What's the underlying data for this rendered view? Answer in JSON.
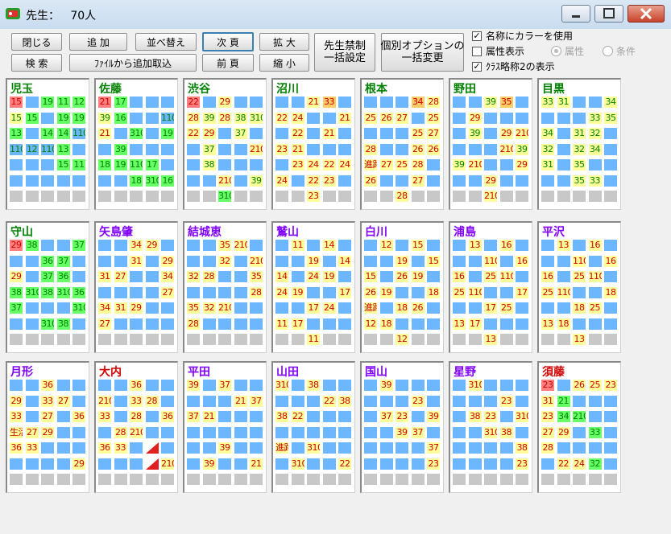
{
  "window": {
    "title_label": "先生：",
    "title_count": "70人"
  },
  "toolbar": {
    "close": "閉じる",
    "add": "追 加",
    "sort": "並べ替え",
    "next_page": "次 頁",
    "zoom_in": "拡 大",
    "search": "検 索",
    "import": "ﾌｧｲﾙから追加取込",
    "prev_page": "前 頁",
    "zoom_out": "縮 小",
    "bulk_ban_1": "先生禁制",
    "bulk_ban_2": "一括設定",
    "bulk_opt_1": "個別オプションの",
    "bulk_opt_2": "一括変更"
  },
  "options": {
    "use_color": "名称にカラーを使用",
    "use_color_checked": true,
    "show_attr": "属性表示",
    "show_attr_checked": false,
    "attr_radio": "属性",
    "cond_radio": "条件",
    "class_abbrev": "ｸﾗｽ略称2の表示",
    "class_abbrev_checked": true
  },
  "colors": {
    "blue": "#6cb7ff",
    "yellow": "#ffff99",
    "green": "#66ff66",
    "pink": "#ff7f7f",
    "orange": "#ffcc66",
    "gray": "#c8c8c8"
  },
  "legend": {
    "b": "blue free slot",
    "y": "yellow",
    "g": "green",
    "p": "pink",
    "o": "orange",
    "x": "gray",
    "w": "empty"
  },
  "teachers": [
    {
      "name": "児玉",
      "name_color": "green",
      "rows": [
        [
          "p:15",
          "b",
          "g:19",
          "g:11",
          "g:12"
        ],
        [
          "y:15",
          "g:15",
          "b",
          "g:19",
          "g:19"
        ],
        [
          "g:13",
          "b",
          "g:14",
          "g:14",
          "b:110"
        ],
        [
          "b:110",
          "b:12",
          "b:110",
          "g:13",
          "b"
        ],
        [
          "b",
          "b",
          "b",
          "g:15",
          "g:11"
        ],
        [
          "b",
          "b",
          "b",
          "b",
          "b"
        ],
        [
          "x",
          "x",
          "x",
          "x",
          "x"
        ]
      ]
    },
    {
      "name": "佐藤",
      "name_color": "green",
      "rows": [
        [
          "p:21",
          "g:17",
          "b",
          "b",
          "b"
        ],
        [
          "y:39",
          "g:16",
          "b",
          "b",
          "b:110"
        ],
        [
          "y:21",
          "b",
          "g:310",
          "b",
          "g:19"
        ],
        [
          "b",
          "g:39",
          "b",
          "b",
          "b"
        ],
        [
          "g:18",
          "g:19",
          "g:110",
          "g:17",
          "b"
        ],
        [
          "b",
          "b",
          "g:18",
          "g:310",
          "g:16"
        ],
        [
          "x",
          "x",
          "x",
          "x",
          "x"
        ]
      ]
    },
    {
      "name": "渋谷",
      "name_color": "green",
      "rows": [
        [
          "p:22",
          "b",
          "y:29",
          "b",
          "b"
        ],
        [
          "y:28",
          "y:39",
          "y:28",
          "y:38",
          "y:310"
        ],
        [
          "y:22",
          "y:29",
          "b",
          "y:37",
          "b"
        ],
        [
          "b",
          "y:37",
          "b",
          "b",
          "y:210"
        ],
        [
          "b",
          "y:38",
          "b",
          "b",
          "b"
        ],
        [
          "b",
          "b",
          "y:210",
          "b",
          "y:39"
        ],
        [
          "x",
          "x",
          "g:310",
          "x",
          "x"
        ]
      ]
    },
    {
      "name": "沼川",
      "name_color": "green",
      "rows": [
        [
          "b",
          "b",
          "y:21",
          "o:33",
          "b"
        ],
        [
          "y:22",
          "y:24",
          "b",
          "b",
          "y:21"
        ],
        [
          "b",
          "y:22",
          "b",
          "y:21",
          "b"
        ],
        [
          "y:23",
          "y:21",
          "b",
          "b",
          "b"
        ],
        [
          "b",
          "y:23",
          "y:24",
          "y:22",
          "y:24"
        ],
        [
          "y:24",
          "b",
          "y:22",
          "y:23",
          "b"
        ],
        [
          "x",
          "x",
          "y:23",
          "x",
          "x"
        ]
      ]
    },
    {
      "name": "根本",
      "name_color": "green",
      "rows": [
        [
          "b",
          "b",
          "b",
          "o:34",
          "y:28"
        ],
        [
          "y:25",
          "y:26",
          "y:27",
          "b",
          "y:25"
        ],
        [
          "b",
          "b",
          "b",
          "y:25",
          "y:27"
        ],
        [
          "y:28",
          "b",
          "b",
          "y:26",
          "y:26"
        ],
        [
          "y:進路",
          "y:27",
          "y:25",
          "y:28",
          "b"
        ],
        [
          "y:26",
          "b",
          "b",
          "y:27",
          "b"
        ],
        [
          "x",
          "x",
          "y:28",
          "x",
          "x"
        ]
      ]
    },
    {
      "name": "野田",
      "name_color": "green",
      "rows": [
        [
          "b",
          "b",
          "y:39",
          "o:35",
          "b"
        ],
        [
          "b",
          "y:29",
          "b",
          "b",
          "b"
        ],
        [
          "b",
          "y:39",
          "b",
          "y:29",
          "y:210"
        ],
        [
          "b",
          "b",
          "b",
          "y:210",
          "y:39"
        ],
        [
          "y:39",
          "y:210",
          "b",
          "b",
          "y:29"
        ],
        [
          "b",
          "b",
          "y:29",
          "b",
          "b"
        ],
        [
          "x",
          "x",
          "y:210",
          "x",
          "x"
        ]
      ]
    },
    {
      "name": "目黒",
      "name_color": "green",
      "rows": [
        [
          "y:33",
          "y:31",
          "b",
          "b",
          "y:34"
        ],
        [
          "b",
          "b",
          "b",
          "y:33",
          "y:35"
        ],
        [
          "y:34",
          "b",
          "y:31",
          "y:32",
          "b"
        ],
        [
          "y:32",
          "b",
          "y:32",
          "y:34",
          "b"
        ],
        [
          "y:31",
          "b",
          "y:35",
          "b",
          "b"
        ],
        [
          "b",
          "b",
          "y:35",
          "y:33",
          "b"
        ],
        [
          "x",
          "x",
          "x",
          "x",
          "x"
        ]
      ]
    },
    {
      "name": "守山",
      "name_color": "green",
      "rows": [
        [
          "p:29",
          "g:38",
          "b",
          "b",
          "g:37"
        ],
        [
          "b",
          "b",
          "g:36",
          "g:37",
          "b"
        ],
        [
          "y:29",
          "b",
          "g:37",
          "g:36",
          "b"
        ],
        [
          "g:38",
          "g:310",
          "g:38",
          "g:310",
          "g:36"
        ],
        [
          "g:37",
          "b",
          "b",
          "b",
          "g:310"
        ],
        [
          "b",
          "b",
          "g:310",
          "g:38",
          "b"
        ],
        [
          "x",
          "x",
          "x",
          "x",
          "x"
        ]
      ]
    },
    {
      "name": "矢島肇",
      "name_color": "purple",
      "rows": [
        [
          "b",
          "b",
          "y:34",
          "y:29",
          "b"
        ],
        [
          "b",
          "b",
          "y:31",
          "b",
          "y:29"
        ],
        [
          "y:31",
          "y:27",
          "b",
          "b",
          "y:34"
        ],
        [
          "b",
          "b",
          "b",
          "b",
          "y:27"
        ],
        [
          "y:34",
          "y:31",
          "y:29",
          "b",
          "b"
        ],
        [
          "y:27",
          "b",
          "b",
          "b",
          "b"
        ],
        [
          "x",
          "x",
          "x",
          "x",
          "x"
        ]
      ]
    },
    {
      "name": "結城恵",
      "name_color": "purple",
      "rows": [
        [
          "b",
          "b",
          "y:35",
          "y:210",
          "b"
        ],
        [
          "b",
          "b",
          "y:32",
          "b",
          "y:210"
        ],
        [
          "y:32",
          "y:28",
          "b",
          "b",
          "y:35"
        ],
        [
          "b",
          "b",
          "b",
          "b",
          "y:28"
        ],
        [
          "y:35",
          "y:32",
          "y:210",
          "b",
          "b"
        ],
        [
          "y:28",
          "b",
          "b",
          "b",
          "b"
        ],
        [
          "x",
          "x",
          "x",
          "x",
          "x"
        ]
      ]
    },
    {
      "name": "鷲山",
      "name_color": "purple",
      "rows": [
        [
          "b",
          "y:11",
          "b",
          "y:14",
          "b"
        ],
        [
          "b",
          "b",
          "y:19",
          "b",
          "y:14"
        ],
        [
          "y:14",
          "b",
          "y:24",
          "y:19",
          "b"
        ],
        [
          "y:24",
          "y:19",
          "b",
          "b",
          "y:17"
        ],
        [
          "b",
          "b",
          "y:17",
          "y:24",
          "b"
        ],
        [
          "y:11",
          "y:17",
          "b",
          "b",
          "b"
        ],
        [
          "x",
          "x",
          "y:11",
          "x",
          "x"
        ]
      ]
    },
    {
      "name": "白川",
      "name_color": "purple",
      "rows": [
        [
          "b",
          "y:12",
          "b",
          "y:15",
          "b"
        ],
        [
          "b",
          "b",
          "y:19",
          "b",
          "y:15"
        ],
        [
          "y:15",
          "b",
          "y:26",
          "y:19",
          "b"
        ],
        [
          "y:26",
          "y:19",
          "b",
          "b",
          "y:18"
        ],
        [
          "y:進路",
          "b",
          "y:18",
          "y:26",
          "b"
        ],
        [
          "y:12",
          "y:18",
          "b",
          "b",
          "b"
        ],
        [
          "x",
          "x",
          "y:12",
          "x",
          "x"
        ]
      ]
    },
    {
      "name": "浦島",
      "name_color": "purple",
      "rows": [
        [
          "b",
          "y:13",
          "b",
          "y:16",
          "b"
        ],
        [
          "b",
          "b",
          "y:110",
          "b",
          "y:16"
        ],
        [
          "y:16",
          "b",
          "y:25",
          "y:110",
          "b"
        ],
        [
          "y:25",
          "y:110",
          "b",
          "b",
          "y:17"
        ],
        [
          "b",
          "b",
          "y:17",
          "y:25",
          "b"
        ],
        [
          "y:13",
          "y:17",
          "b",
          "b",
          "b"
        ],
        [
          "x",
          "x",
          "y:13",
          "x",
          "x"
        ]
      ]
    },
    {
      "name": "平沢",
      "name_color": "purple",
      "rows": [
        [
          "b",
          "y:13",
          "b",
          "y:16",
          "b"
        ],
        [
          "b",
          "b",
          "y:110",
          "b",
          "y:16"
        ],
        [
          "y:16",
          "b",
          "y:25",
          "y:110",
          "b"
        ],
        [
          "y:25",
          "y:110",
          "b",
          "b",
          "y:18"
        ],
        [
          "b",
          "b",
          "y:18",
          "y:25",
          "b"
        ],
        [
          "y:13",
          "y:18",
          "b",
          "b",
          "b"
        ],
        [
          "x",
          "x",
          "y:13",
          "x",
          "x"
        ]
      ]
    },
    {
      "name": "月形",
      "name_color": "purple",
      "rows": [
        [
          "b",
          "b",
          "y:36",
          "b",
          "b"
        ],
        [
          "y:29",
          "b",
          "y:33",
          "y:27",
          "b"
        ],
        [
          "y:33",
          "b",
          "y:27",
          "b",
          "y:36"
        ],
        [
          "y:生活",
          "y:27",
          "y:29",
          "b",
          "b"
        ],
        [
          "y:36",
          "y:33",
          "b",
          "b",
          "b"
        ],
        [
          "b",
          "b",
          "b",
          "b",
          "y:29"
        ],
        [
          "x",
          "x",
          "x",
          "x",
          "x"
        ]
      ]
    },
    {
      "name": "大内",
      "name_color": "red",
      "rows": [
        [
          "b",
          "b",
          "y:36",
          "b",
          "b"
        ],
        [
          "y:210",
          "b",
          "y:33",
          "y:28",
          "b"
        ],
        [
          "y:33",
          "b",
          "y:28",
          "b",
          "y:36"
        ],
        [
          "b",
          "y:28",
          "y:210",
          "b",
          "b"
        ],
        [
          "y:36",
          "y:33",
          "b",
          "tri",
          "b"
        ],
        [
          "b",
          "b",
          "b",
          "tri",
          "y:210"
        ],
        [
          "x",
          "x",
          "x",
          "x",
          "x"
        ]
      ]
    },
    {
      "name": "平田",
      "name_color": "purple",
      "rows": [
        [
          "y:39",
          "b",
          "y:37",
          "b",
          "b"
        ],
        [
          "b",
          "b",
          "b",
          "y:21",
          "y:37"
        ],
        [
          "y:37",
          "y:21",
          "b",
          "b",
          "b"
        ],
        [
          "b",
          "b",
          "b",
          "b",
          "b"
        ],
        [
          "b",
          "b",
          "y:39",
          "b",
          "b"
        ],
        [
          "b",
          "y:39",
          "b",
          "b",
          "y:21"
        ],
        [
          "x",
          "x",
          "x",
          "x",
          "x"
        ]
      ]
    },
    {
      "name": "山田",
      "name_color": "purple",
      "rows": [
        [
          "y:310",
          "b",
          "y:38",
          "b",
          "b"
        ],
        [
          "b",
          "b",
          "b",
          "y:22",
          "y:38"
        ],
        [
          "y:38",
          "y:22",
          "b",
          "b",
          "b"
        ],
        [
          "b",
          "b",
          "b",
          "b",
          "b"
        ],
        [
          "y:進路",
          "b",
          "y:310",
          "b",
          "b"
        ],
        [
          "b",
          "y:310",
          "b",
          "b",
          "y:22"
        ],
        [
          "x",
          "x",
          "x",
          "x",
          "x"
        ]
      ]
    },
    {
      "name": "国山",
      "name_color": "purple",
      "rows": [
        [
          "b",
          "y:39",
          "b",
          "b",
          "b"
        ],
        [
          "b",
          "b",
          "b",
          "y:23",
          "b"
        ],
        [
          "b",
          "y:37",
          "y:23",
          "b",
          "y:39"
        ],
        [
          "b",
          "b",
          "y:39",
          "y:37",
          "b"
        ],
        [
          "b",
          "b",
          "b",
          "b",
          "y:37"
        ],
        [
          "b",
          "b",
          "b",
          "b",
          "y:23"
        ],
        [
          "x",
          "x",
          "x",
          "x",
          "x"
        ]
      ]
    },
    {
      "name": "星野",
      "name_color": "purple",
      "rows": [
        [
          "b",
          "y:310",
          "b",
          "b",
          "b"
        ],
        [
          "b",
          "b",
          "b",
          "y:23",
          "b"
        ],
        [
          "b",
          "y:38",
          "y:23",
          "b",
          "y:310"
        ],
        [
          "b",
          "b",
          "y:310",
          "y:38",
          "b"
        ],
        [
          "b",
          "b",
          "b",
          "b",
          "y:38"
        ],
        [
          "b",
          "b",
          "b",
          "b",
          "y:23"
        ],
        [
          "x",
          "x",
          "x",
          "x",
          "x"
        ]
      ]
    },
    {
      "name": "須藤",
      "name_color": "red",
      "rows": [
        [
          "p:23",
          "b",
          "y:26",
          "y:25",
          "y:23"
        ],
        [
          "y:31",
          "g:21",
          "b",
          "b",
          "b"
        ],
        [
          "y:23",
          "g:34",
          "g:210",
          "b",
          "b"
        ],
        [
          "y:27",
          "y:29",
          "b",
          "g:33",
          "b"
        ],
        [
          "y:28",
          "b",
          "b",
          "b",
          "b"
        ],
        [
          "b",
          "y:22",
          "y:24",
          "g:32",
          "b"
        ],
        [
          "x",
          "x",
          "x",
          "x",
          "x"
        ]
      ]
    }
  ]
}
